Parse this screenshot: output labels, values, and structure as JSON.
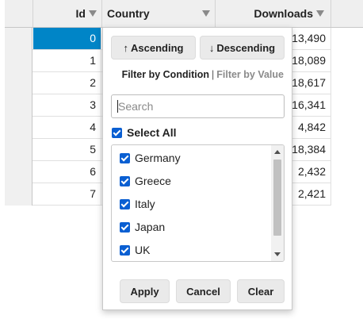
{
  "grid": {
    "columns": [
      {
        "key": "id",
        "label": "Id"
      },
      {
        "key": "country",
        "label": "Country"
      },
      {
        "key": "downloads",
        "label": "Downloads"
      }
    ],
    "rows": [
      {
        "id": "0",
        "downloads": "13,490"
      },
      {
        "id": "1",
        "downloads": "18,089"
      },
      {
        "id": "2",
        "downloads": "18,617"
      },
      {
        "id": "3",
        "downloads": "16,341"
      },
      {
        "id": "4",
        "downloads": "4,842"
      },
      {
        "id": "5",
        "downloads": "18,384"
      },
      {
        "id": "6",
        "downloads": "2,432"
      },
      {
        "id": "7",
        "downloads": "2,421"
      }
    ],
    "selected_color": "#0085c7"
  },
  "filter": {
    "ascending_label": "Ascending",
    "descending_label": "Descending",
    "ascending_arrow": "↑",
    "descending_arrow": "↓",
    "by_condition_label": "Filter by Condition",
    "separator": "|",
    "by_value_label": "Filter by Value",
    "search_placeholder": "Search",
    "select_all_label": "Select All",
    "select_all_checked": true,
    "items": [
      {
        "label": "Germany",
        "checked": true
      },
      {
        "label": "Greece",
        "checked": true
      },
      {
        "label": "Italy",
        "checked": true
      },
      {
        "label": "Japan",
        "checked": true
      },
      {
        "label": "UK",
        "checked": true
      }
    ],
    "apply_label": "Apply",
    "cancel_label": "Cancel",
    "clear_label": "Clear",
    "checkbox_color": "#0a5fd2"
  }
}
